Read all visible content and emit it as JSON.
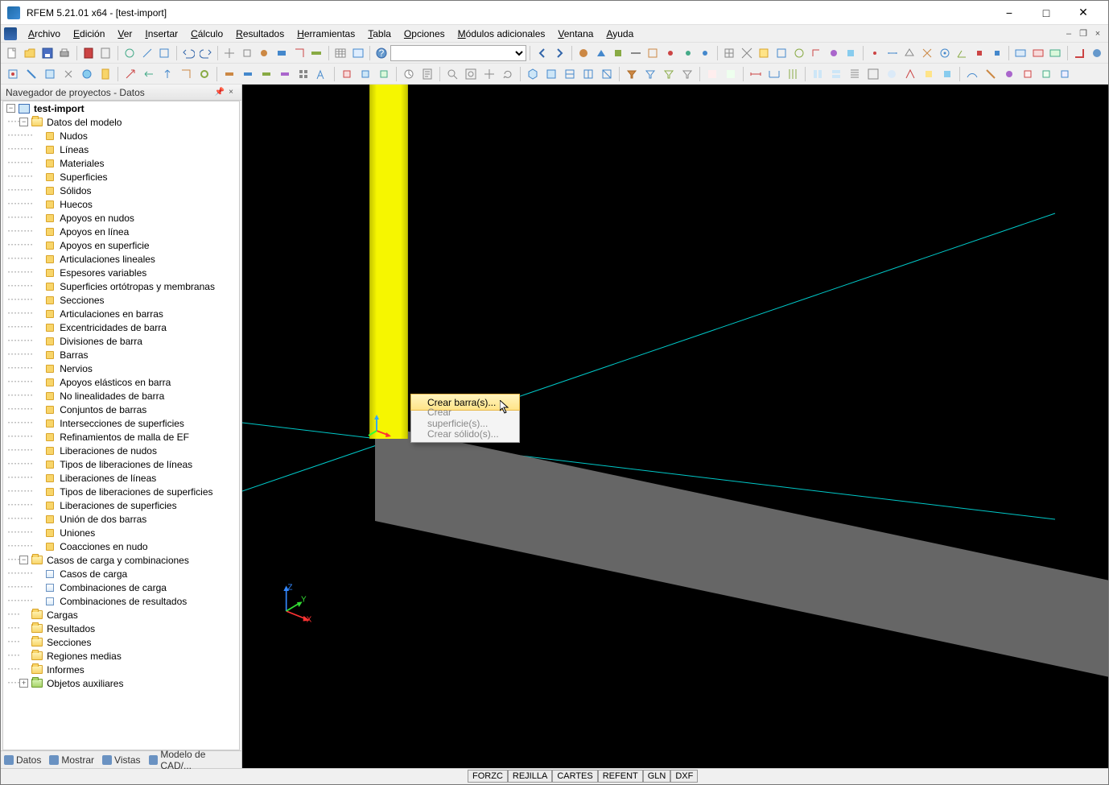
{
  "app": {
    "title": "RFEM 5.21.01 x64 - [test-import]"
  },
  "menu": {
    "items": [
      "Archivo",
      "Edición",
      "Ver",
      "Insertar",
      "Cálculo",
      "Resultados",
      "Herramientas",
      "Tabla",
      "Opciones",
      "Módulos adicionales",
      "Ventana",
      "Ayuda"
    ]
  },
  "navigator": {
    "title": "Navegador de proyectos - Datos",
    "root": "test-import",
    "modelData": "Datos del modelo",
    "modelChildren": [
      "Nudos",
      "Líneas",
      "Materiales",
      "Superficies",
      "Sólidos",
      "Huecos",
      "Apoyos en nudos",
      "Apoyos en línea",
      "Apoyos en superficie",
      "Articulaciones lineales",
      "Espesores variables",
      "Superficies ortótropas y membranas",
      "Secciones",
      "Articulaciones en barras",
      "Excentricidades de barra",
      "Divisiones de barra",
      "Barras",
      "Nervios",
      "Apoyos elásticos en barra",
      "No linealidades de barra",
      "Conjuntos de barras",
      "Intersecciones de superficies",
      "Refinamientos de malla de EF",
      "Liberaciones de nudos",
      "Tipos de liberaciones de líneas",
      "Liberaciones de líneas",
      "Tipos de liberaciones de superficies",
      "Liberaciones de superficies",
      "Unión de dos barras",
      "Uniones",
      "Coacciones en nudo"
    ],
    "loadData": "Casos de carga y combinaciones",
    "loadChildren": [
      "Casos de carga",
      "Combinaciones de carga",
      "Combinaciones de resultados"
    ],
    "otherFolders": [
      "Cargas",
      "Resultados",
      "Secciones",
      "Regiones medias",
      "Informes",
      "Objetos auxiliares"
    ]
  },
  "sidebarTabs": [
    "Datos",
    "Mostrar",
    "Vistas",
    "Modelo de CAD/..."
  ],
  "contextMenu": {
    "items": [
      "Crear barra(s)...",
      "Crear superficie(s)...",
      "Crear sólido(s)..."
    ]
  },
  "statusCells": [
    "FORZC",
    "REJILLA",
    "CARTES",
    "REFENT",
    "GLN",
    "DXF"
  ],
  "axis": {
    "x": "X",
    "y": "Y",
    "z": "Z"
  }
}
